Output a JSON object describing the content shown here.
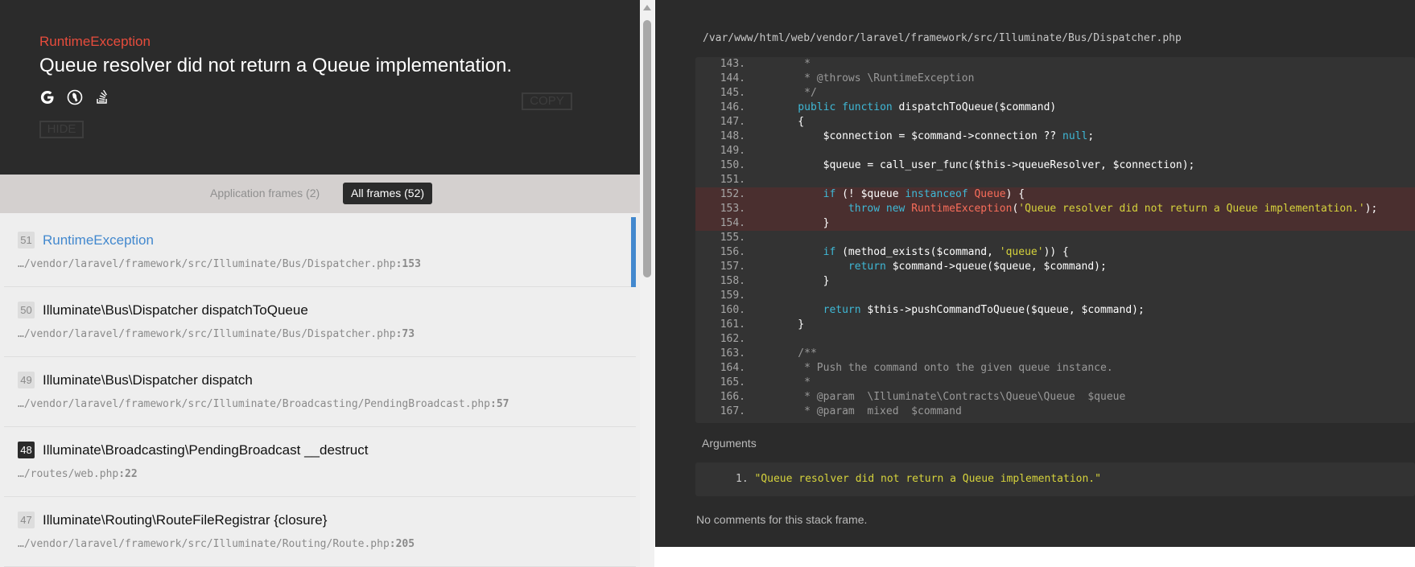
{
  "header": {
    "exception_class": "RuntimeException",
    "exception_message": "Queue resolver did not return a Queue implementation.",
    "copy_label": "COPY",
    "hide_label": "HIDE",
    "search_icons": [
      "google-icon",
      "duckduckgo-icon",
      "stackoverflow-icon"
    ]
  },
  "filters": {
    "application": "Application frames (2)",
    "all": "All frames (52)"
  },
  "frames": [
    {
      "index": "51",
      "title": "RuntimeException",
      "path": "…/vendor/laravel/framework/src/Illuminate/Bus/Dispatcher.php",
      "line": ":153"
    },
    {
      "index": "50",
      "title": "Illuminate\\Bus\\Dispatcher dispatchToQueue",
      "path": "…/vendor/laravel/framework/src/Illuminate/Bus/Dispatcher.php",
      "line": ":73"
    },
    {
      "index": "49",
      "title": "Illuminate\\Bus\\Dispatcher dispatch",
      "path": "…/vendor/laravel/framework/src/Illuminate/Broadcasting/PendingBroadcast.php",
      "line": ":57"
    },
    {
      "index": "48",
      "title": "Illuminate\\Broadcasting\\PendingBroadcast __destruct",
      "path": "…/routes/web.php",
      "line": ":22"
    },
    {
      "index": "47",
      "title": "Illuminate\\Routing\\RouteFileRegistrar {closure}",
      "path": "…/vendor/laravel/framework/src/Illuminate/Routing/Route.php",
      "line": ":205"
    }
  ],
  "code": {
    "file_path": "/var/www/html/web/vendor/laravel/framework/src/Illuminate/Bus/Dispatcher.php",
    "line_numbers": [
      "143.",
      "144.",
      "145.",
      "146.",
      "147.",
      "148.",
      "149.",
      "150.",
      "151.",
      "152.",
      "153.",
      "154.",
      "155.",
      "156.",
      "157.",
      "158.",
      "159.",
      "160.",
      "161.",
      "162.",
      "163.",
      "164.",
      "165.",
      "166.",
      "167."
    ],
    "segments": {
      "l143": "     *",
      "l144": "     * @throws \\RuntimeException",
      "l145": "     */",
      "l146_kw1": "    public",
      "l146_kw2": " function",
      "l146_rest": " dispatchToQueue($command)",
      "l147": "    {",
      "l148_a": "        $connection = $command->connection ?? ",
      "l148_null": "null",
      "l148_b": ";",
      "l150": "        $queue = call_user_func($this->queueResolver, $connection);",
      "l152_a": "        ",
      "l152_if": "if",
      "l152_b": " (! $queue ",
      "l152_inst": "instanceof",
      "l152_sp": " ",
      "l152_cls": "Queue",
      "l152_c": ") {",
      "l153_a": "            ",
      "l153_throw": "throw",
      "l153_sp1": " ",
      "l153_new": "new",
      "l153_sp2": " ",
      "l153_cls": "RuntimeException",
      "l153_b": "(",
      "l153_str": "'Queue resolver did not return a Queue implementation.'",
      "l153_c": ");",
      "l154": "        }",
      "l156_a": "        ",
      "l156_if": "if",
      "l156_b": " (method_exists($command, ",
      "l156_str": "'queue'",
      "l156_c": ")) {",
      "l157_a": "            ",
      "l157_ret": "return",
      "l157_b": " $command->queue($queue, $command);",
      "l158": "        }",
      "l160_a": "        ",
      "l160_ret": "return",
      "l160_b": " $this->pushCommandToQueue($queue, $command);",
      "l161": "    }",
      "l163": "    /**",
      "l164": "     * Push the command onto the given queue instance.",
      "l165": "     *",
      "l166": "     * @param  \\Illuminate\\Contracts\\Queue\\Queue  $queue",
      "l167": "     * @param  mixed  $command"
    }
  },
  "arguments": {
    "label": "Arguments",
    "item_number": "1.",
    "item_value": "\"Queue resolver did not return a Queue implementation.\""
  },
  "comments": {
    "text": "No comments for this stack frame."
  }
}
